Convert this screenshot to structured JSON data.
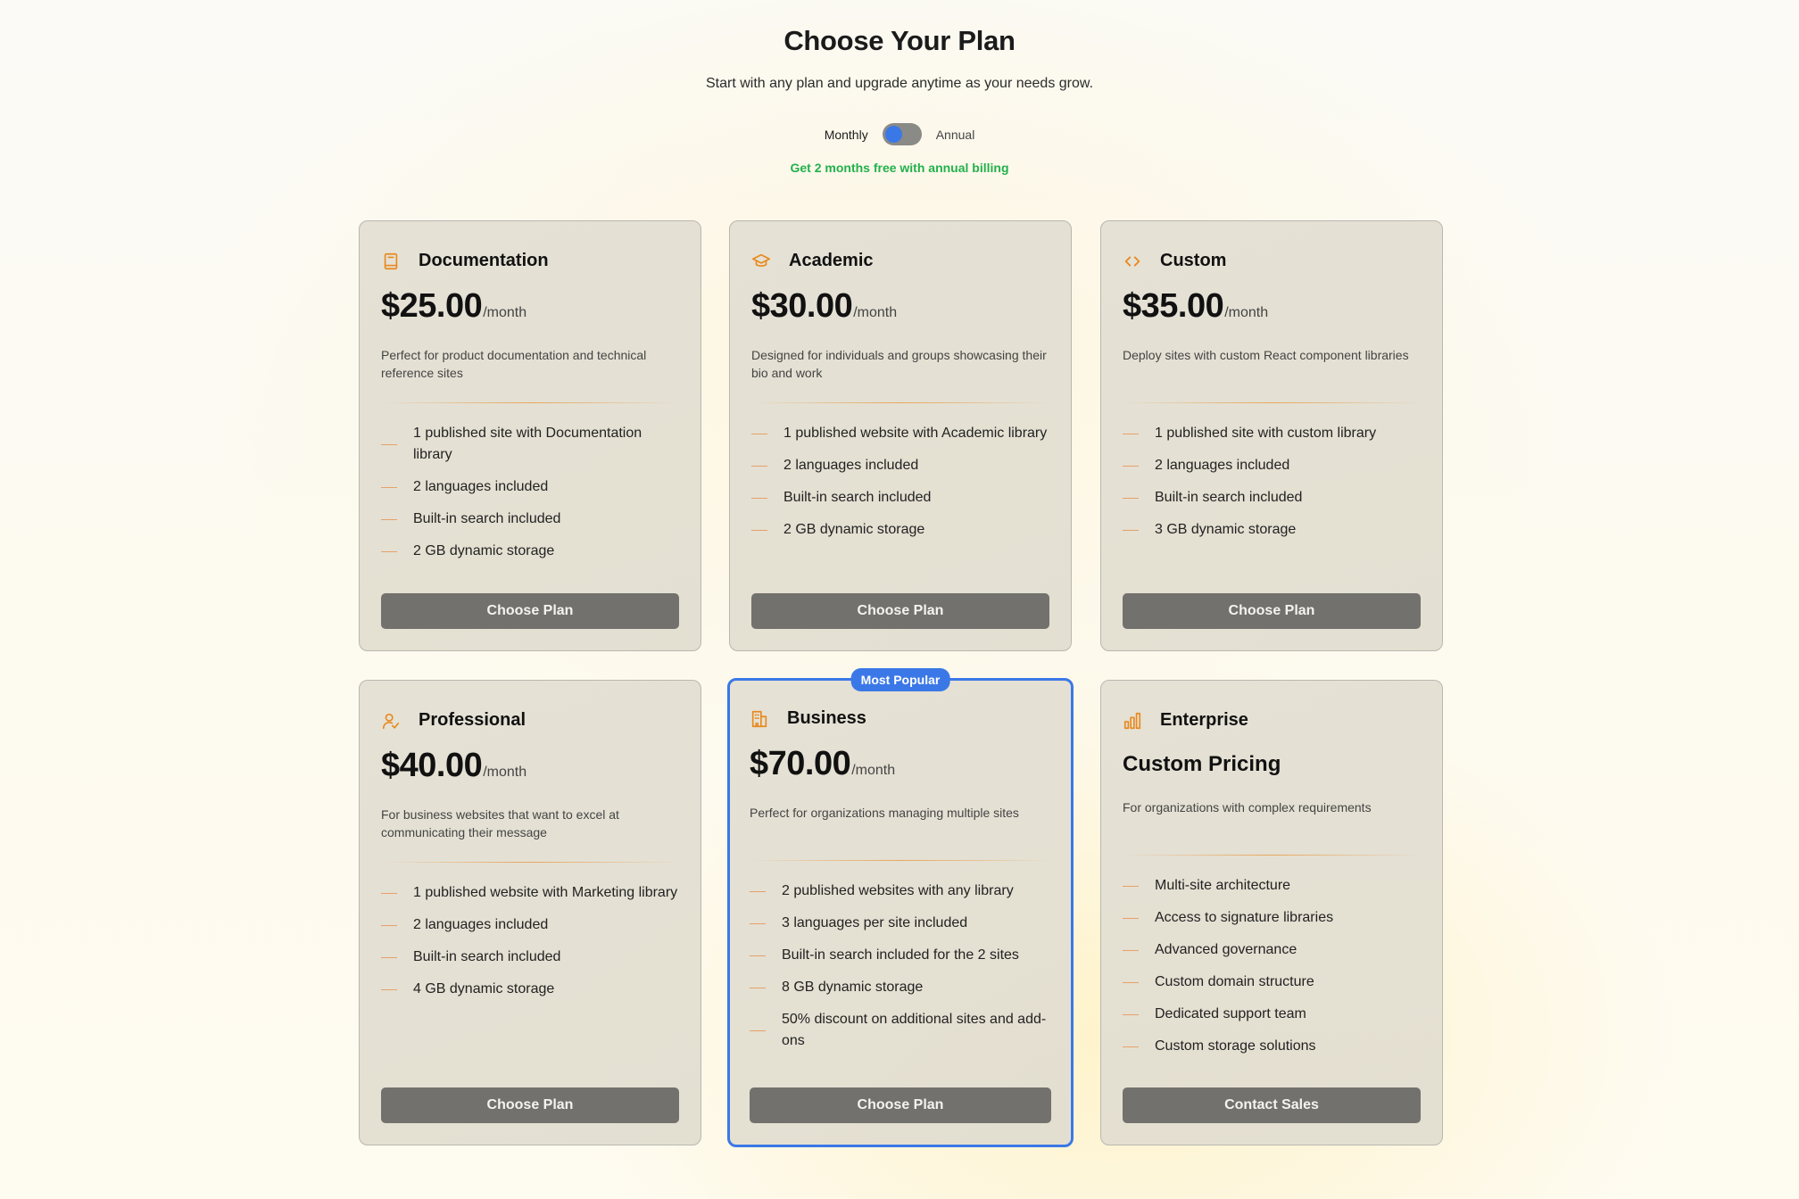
{
  "header": {
    "title": "Choose Your Plan",
    "subtitle": "Start with any plan and upgrade anytime as your needs grow."
  },
  "billing": {
    "monthly_label": "Monthly",
    "annual_label": "Annual",
    "selected": "Monthly",
    "promo": "Get 2 months free with annual billing"
  },
  "colors": {
    "accent": "#3b78e7",
    "icon_orange": "#e8891f",
    "promo_green": "#22b14c",
    "button": "#72716d"
  },
  "plans": [
    {
      "name": "Documentation",
      "icon": "book-icon",
      "price": "$25.00",
      "period": "/month",
      "description": "Perfect for product documentation and technical reference sites",
      "features": [
        "1 published site with Documentation library",
        "2 languages included",
        "Built-in search included",
        "2 GB dynamic storage"
      ],
      "cta": "Choose Plan"
    },
    {
      "name": "Academic",
      "icon": "graduation-cap-icon",
      "price": "$30.00",
      "period": "/month",
      "description": "Designed for individuals and groups showcasing their bio and work",
      "features": [
        "1 published website with Academic library",
        "2 languages included",
        "Built-in search included",
        "2 GB dynamic storage"
      ],
      "cta": "Choose Plan"
    },
    {
      "name": "Custom",
      "icon": "code-icon",
      "price": "$35.00",
      "period": "/month",
      "description": "Deploy sites with custom React component libraries",
      "features": [
        "1 published site with custom library",
        "2 languages included",
        "Built-in search included",
        "3 GB dynamic storage"
      ],
      "cta": "Choose Plan"
    },
    {
      "name": "Professional",
      "icon": "user-check-icon",
      "price": "$40.00",
      "period": "/month",
      "description": "For business websites that want to excel at communicating their message",
      "features": [
        "1 published website with Marketing library",
        "2 languages included",
        "Built-in search included",
        "4 GB dynamic storage"
      ],
      "cta": "Choose Plan"
    },
    {
      "name": "Business",
      "icon": "building-icon",
      "badge": "Most Popular",
      "price": "$70.00",
      "period": "/month",
      "description": "Perfect for organizations managing multiple sites",
      "features": [
        "2 published websites with any library",
        "3 languages per site included",
        "Built-in search included for the 2 sites",
        "8 GB dynamic storage",
        "50% discount on additional sites and add-ons"
      ],
      "cta": "Choose Plan"
    },
    {
      "name": "Enterprise",
      "icon": "bar-chart-icon",
      "price_label": "Custom Pricing",
      "description": "For organizations with complex requirements",
      "features": [
        "Multi-site architecture",
        "Access to signature libraries",
        "Advanced governance",
        "Custom domain structure",
        "Dedicated support team",
        "Custom storage solutions"
      ],
      "cta": "Contact Sales"
    }
  ]
}
